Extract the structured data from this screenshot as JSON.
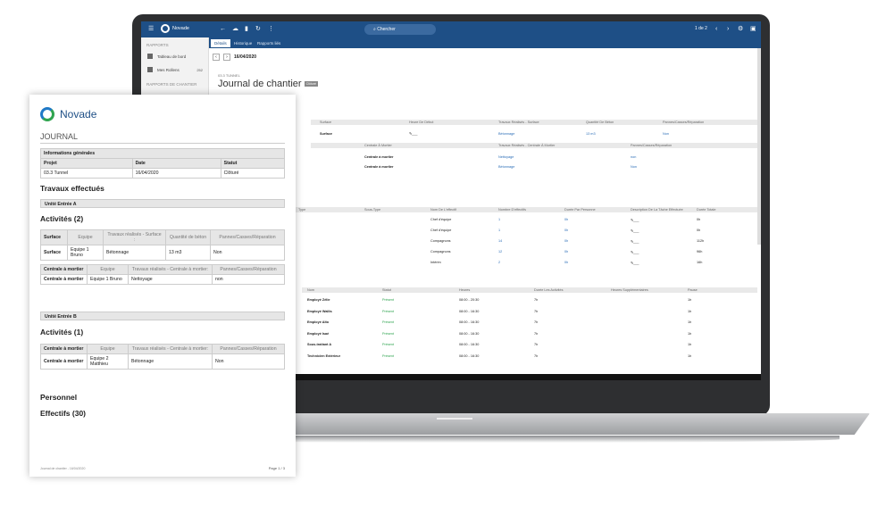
{
  "app": {
    "brand": "Novade",
    "search_placeholder": "Chercher",
    "pager": "1 de 2",
    "tabs": [
      "Détails",
      "Historique",
      "Rapports liés"
    ],
    "sidebar": {
      "sections": [
        {
          "label": "RAPPORTS",
          "items": [
            {
              "label": "Tableau de bord",
              "badge": ""
            },
            {
              "label": "Mes Rollens",
              "badge": "252"
            }
          ]
        },
        {
          "label": "RAPPORTS DE CHANTIER",
          "items": []
        }
      ]
    },
    "date": "16/04/2020",
    "project_label": "03.3 TUNNEL",
    "title": "Journal de chantier",
    "status_badge": "Clôturé",
    "table1": {
      "headers": [
        "Surface",
        "Heure De Début",
        "Travaux Réalisés - Surface",
        "Quantité De Béton",
        "Pannes/Casses/Réparation"
      ],
      "row": {
        "surface": "Surface",
        "travaux": "Bétonnage",
        "quantite": "13 m3",
        "pannes": "Non"
      }
    },
    "table2": {
      "headers": [
        "Centrale À Mortier",
        "Travaux Réalisés - Centrale À Mortier",
        "Pannes/Casses/Réparation"
      ],
      "rows": [
        {
          "a": "Centrale à mortier",
          "b": "Nettoyage",
          "c": "non"
        },
        {
          "a": "Centrale à mortier",
          "b": "Bétonnage",
          "c": "Non"
        }
      ]
    },
    "table3": {
      "headers": [
        "Type",
        "Sous-Type",
        "Nom De L'effectif",
        "Nombre D'effectifs",
        "Durée Par Personne",
        "Description De La Tâche Effectuée",
        "Durée Totale"
      ],
      "rows": [
        {
          "nom": "Chef d'équipe",
          "nb": "1",
          "duree": "0h",
          "total": "0h"
        },
        {
          "nom": "Chef d'équipe",
          "nb": "1",
          "duree": "0h",
          "total": "0h"
        },
        {
          "nom": "Compagnons",
          "nb": "14",
          "duree": "0h",
          "total": "112h"
        },
        {
          "nom": "Compagnons",
          "nb": "12",
          "duree": "0h",
          "total": "96h"
        },
        {
          "nom": "Intérim",
          "nb": "2",
          "duree": "0h",
          "total": "16h"
        }
      ]
    },
    "table4": {
      "headers": [
        "Nom",
        "Statut",
        "Heures",
        "Durée Les Activités",
        "Heures Supplémentaires",
        "Pause"
      ],
      "rows": [
        {
          "nom": "Employé Zélie",
          "statut": "Présent",
          "heures": "08:00 - 20:30",
          "duree": "7h",
          "pause": "1h"
        },
        {
          "nom": "Employé Wallis",
          "statut": "Présent",
          "heures": "08:00 - 16:30",
          "duree": "7h",
          "pause": "1h"
        },
        {
          "nom": "Employé Alto",
          "statut": "Présent",
          "heures": "08:00 - 16:30",
          "duree": "7h",
          "pause": "1h"
        },
        {
          "nom": "Employé Isaé",
          "statut": "Présent",
          "heures": "08:00 - 16:30",
          "duree": "7h",
          "pause": "1h"
        },
        {
          "nom": "Sous-traitant A",
          "statut": "Présent",
          "heures": "08:00 - 16:30",
          "duree": "7h",
          "pause": "1h"
        },
        {
          "nom": "Technicien Extérieur",
          "statut": "Présent",
          "heures": "08:00 - 16:30",
          "duree": "7h",
          "pause": "1h"
        }
      ]
    }
  },
  "report": {
    "brand": "Novade",
    "heading": "JOURNAL",
    "info": {
      "title": "Informations générales",
      "headers": [
        "Projet",
        "Date",
        "Statut"
      ],
      "values": [
        "03.3 Tunnel",
        "16/04/2020",
        "Clôturé"
      ]
    },
    "travaux_title": "Travaux effectués",
    "unit_a": "Unité Entrée A",
    "activites_a": "Activités (2)",
    "surface_table": {
      "headers": [
        "Surface",
        "Equipe",
        "Travaux réalisés - Surface :",
        "Quantité de béton",
        "Pannes/Casses/Réparation"
      ],
      "row": [
        "Surface",
        "Equipe 1 Bruno",
        "Bétonnage",
        "13 m3",
        "Non"
      ]
    },
    "centrale_table_a": {
      "headers": [
        "Centrale à mortier",
        "Equipe",
        "Travaux réalisés - Centrale à mortier:",
        "Pannes/Casses/Réparation"
      ],
      "row": [
        "Centrale à mortier",
        "Equipe 1 Bruno",
        "Nettoyage",
        "non"
      ]
    },
    "unit_b": "Unité Entrée B",
    "activites_b": "Activités (1)",
    "centrale_table_b": {
      "headers": [
        "Centrale à mortier",
        "Equipe",
        "Travaux réalisés - Centrale à mortier:",
        "Pannes/Casses/Réparation"
      ],
      "row": [
        "Centrale à mortier",
        "Equipe 2 Matthieu",
        "Bétonnage",
        "Non"
      ]
    },
    "personnel_title": "Personnel",
    "effectifs_title": "Effectifs (30)",
    "footer_left": "Journal de chantier - 16/04/2020",
    "footer_right": "Page 1 / 3"
  }
}
